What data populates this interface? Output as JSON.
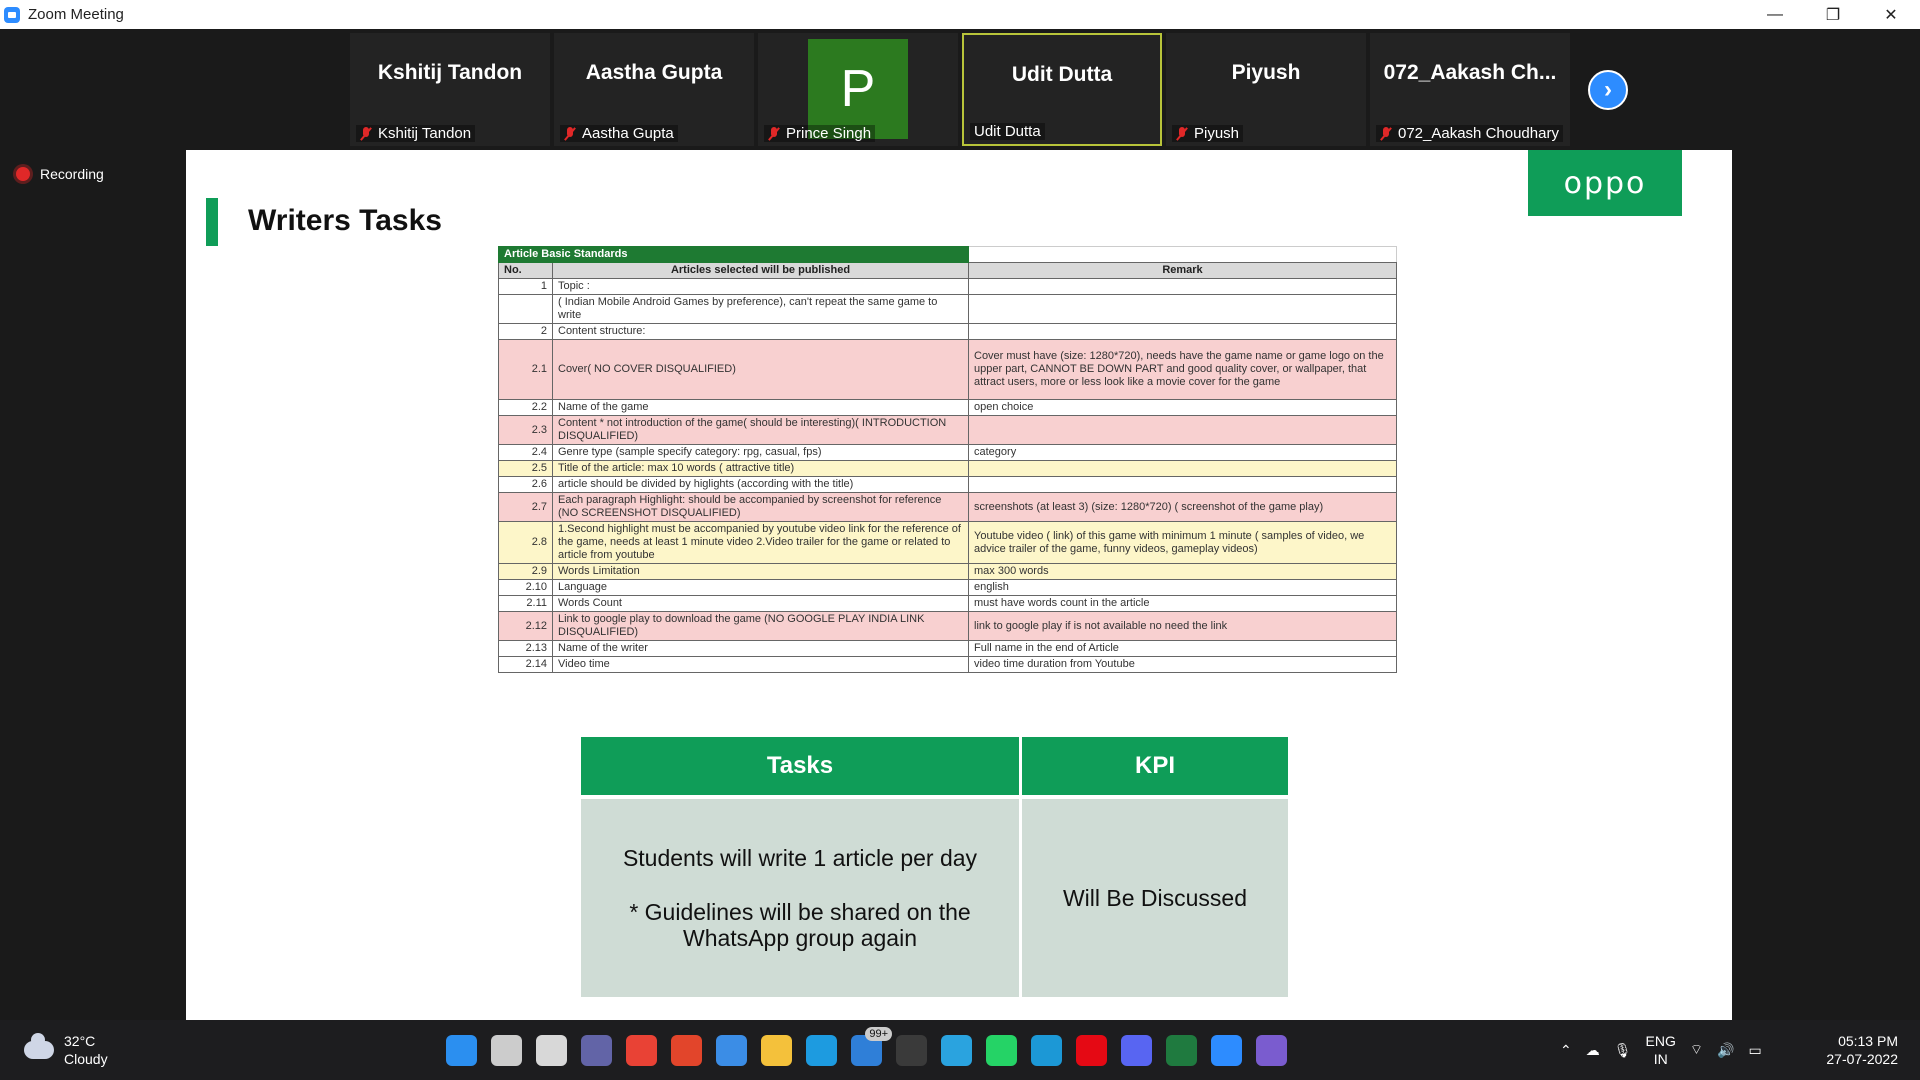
{
  "window": {
    "title": "Zoom Meeting",
    "controls": [
      "—",
      "❐",
      "✕"
    ]
  },
  "participants": [
    {
      "display": "Kshitij Tandon",
      "label": "Kshitij Tandon",
      "muted": true
    },
    {
      "display": "Aastha Gupta",
      "label": "Aastha Gupta",
      "muted": true
    },
    {
      "display": "P",
      "label": "Prince Singh",
      "muted": true
    },
    {
      "display": "Udit Dutta",
      "label": "Udit Dutta",
      "muted": false
    },
    {
      "display": "Piyush",
      "label": "Piyush",
      "muted": true
    },
    {
      "display": "072_Aakash  Ch...",
      "label": "072_Aakash Choudhary",
      "muted": true
    }
  ],
  "next_icon": "›",
  "recording": {
    "label": "Recording"
  },
  "slide": {
    "logo": "oppo",
    "title": "Writers Tasks",
    "standards": {
      "header": "Article Basic Standards",
      "columns": [
        "No.",
        "Articles selected will be published",
        "Remark"
      ],
      "rows": [
        {
          "no": "1",
          "item": "Topic :",
          "remark": ""
        },
        {
          "no": "",
          "item": "( Indian Mobile Android Games by preference), can't repeat the same game to write",
          "remark": ""
        },
        {
          "no": "2",
          "item": "Content structure:",
          "remark": ""
        },
        {
          "no": "2.1",
          "item": "Cover( NO COVER DISQUALIFIED)",
          "remark": "Cover must have (size:  1280*720), needs have the game name or game logo on the upper part,  CANNOT BE DOWN PART and good quality cover, or wallpaper, that attract users, more or less look like a movie cover for the game"
        },
        {
          "no": "2.2",
          "item": "Name of the game",
          "remark": "open choice"
        },
        {
          "no": "2.3",
          "item": "Content * not introduction of the game( should be interesting)( INTRODUCTION DISQUALIFIED)",
          "remark": ""
        },
        {
          "no": "2.4",
          "item": "Genre type (sample specify category: rpg, casual, fps)",
          "remark": "category"
        },
        {
          "no": "2.5",
          "item": "Title of the article: max 10 words ( attractive title)",
          "remark": ""
        },
        {
          "no": "2.6",
          "item": "article should be divided by higlights (according with the title)",
          "remark": ""
        },
        {
          "no": "2.7",
          "item": "Each paragraph Highlight: should be accompanied by screenshot for reference (NO SCREENSHOT DISQUALIFIED)",
          "remark": "screenshots (at least 3) (size:  1280*720) ( screenshot of the game play)"
        },
        {
          "no": "2.8",
          "item": "1.Second highlight must be accompanied by youtube video link for the reference of the game, needs at least 1 minute video 2.Video trailer for the game or related to article from youtube",
          "remark": "Youtube video ( link) of this game with minimum 1 minute ( samples of video, we advice trailer of the game, funny videos, gameplay videos)"
        },
        {
          "no": "2.9",
          "item": "Words Limitation",
          "remark": "max 300 words"
        },
        {
          "no": "2.10",
          "item": "Language",
          "remark": "english"
        },
        {
          "no": "2.11",
          "item": "Words Count",
          "remark": "must have words count in the article"
        },
        {
          "no": "2.12",
          "item": "Link to google play to download the game (NO GOOGLE PLAY  INDIA LINK DISQUALIFIED)",
          "remark": "link to google play if is not available no need the link"
        },
        {
          "no": "2.13",
          "item": "Name of the writer",
          "remark": "Full name in the end of Article"
        },
        {
          "no": "2.14",
          "item": "Video time",
          "remark": "video time duration from Youtube"
        }
      ]
    },
    "tasks_table": {
      "headers": [
        "Tasks",
        "KPI"
      ],
      "task_line1": "Students will write 1 article per day",
      "task_line2": "* Guidelines will be shared on the WhatsApp group again",
      "kpi": "Will Be Discussed"
    }
  },
  "taskbar": {
    "weather": {
      "temp": "32°C",
      "condition": "Cloudy"
    },
    "apps": [
      {
        "name": "start-icon",
        "color": "#2b8ff0"
      },
      {
        "name": "search-icon",
        "color": "#cccccc"
      },
      {
        "name": "task-view-icon",
        "color": "#d8d8d8"
      },
      {
        "name": "teams-chat-icon",
        "color": "#6264a7"
      },
      {
        "name": "chrome-icon",
        "color": "#e94235"
      },
      {
        "name": "office-icon",
        "color": "#e2452b"
      },
      {
        "name": "todo-icon",
        "color": "#3b8de6"
      },
      {
        "name": "file-explorer-icon",
        "color": "#f4c13b"
      },
      {
        "name": "edge-icon",
        "color": "#1d9be0"
      },
      {
        "name": "mail-icon",
        "color": "#2f7fd8",
        "badge": "99+"
      },
      {
        "name": "dell-icon",
        "color": "#3a3a3a"
      },
      {
        "name": "telegram-icon",
        "color": "#2aa3df"
      },
      {
        "name": "whatsapp-icon",
        "color": "#25d366"
      },
      {
        "name": "prime-video-icon",
        "color": "#1c98d6"
      },
      {
        "name": "netflix-icon",
        "color": "#e50914"
      },
      {
        "name": "discord-icon",
        "color": "#5865f2"
      },
      {
        "name": "excel-icon",
        "color": "#1f7a3f"
      },
      {
        "name": "zoom-icon",
        "color": "#2d8cff"
      },
      {
        "name": "app-icon",
        "color": "#7a5ccf"
      }
    ],
    "tray": {
      "lang_line1": "ENG",
      "lang_line2": "IN"
    },
    "clock": {
      "time": "05:13 PM",
      "date": "27-07-2022"
    }
  }
}
